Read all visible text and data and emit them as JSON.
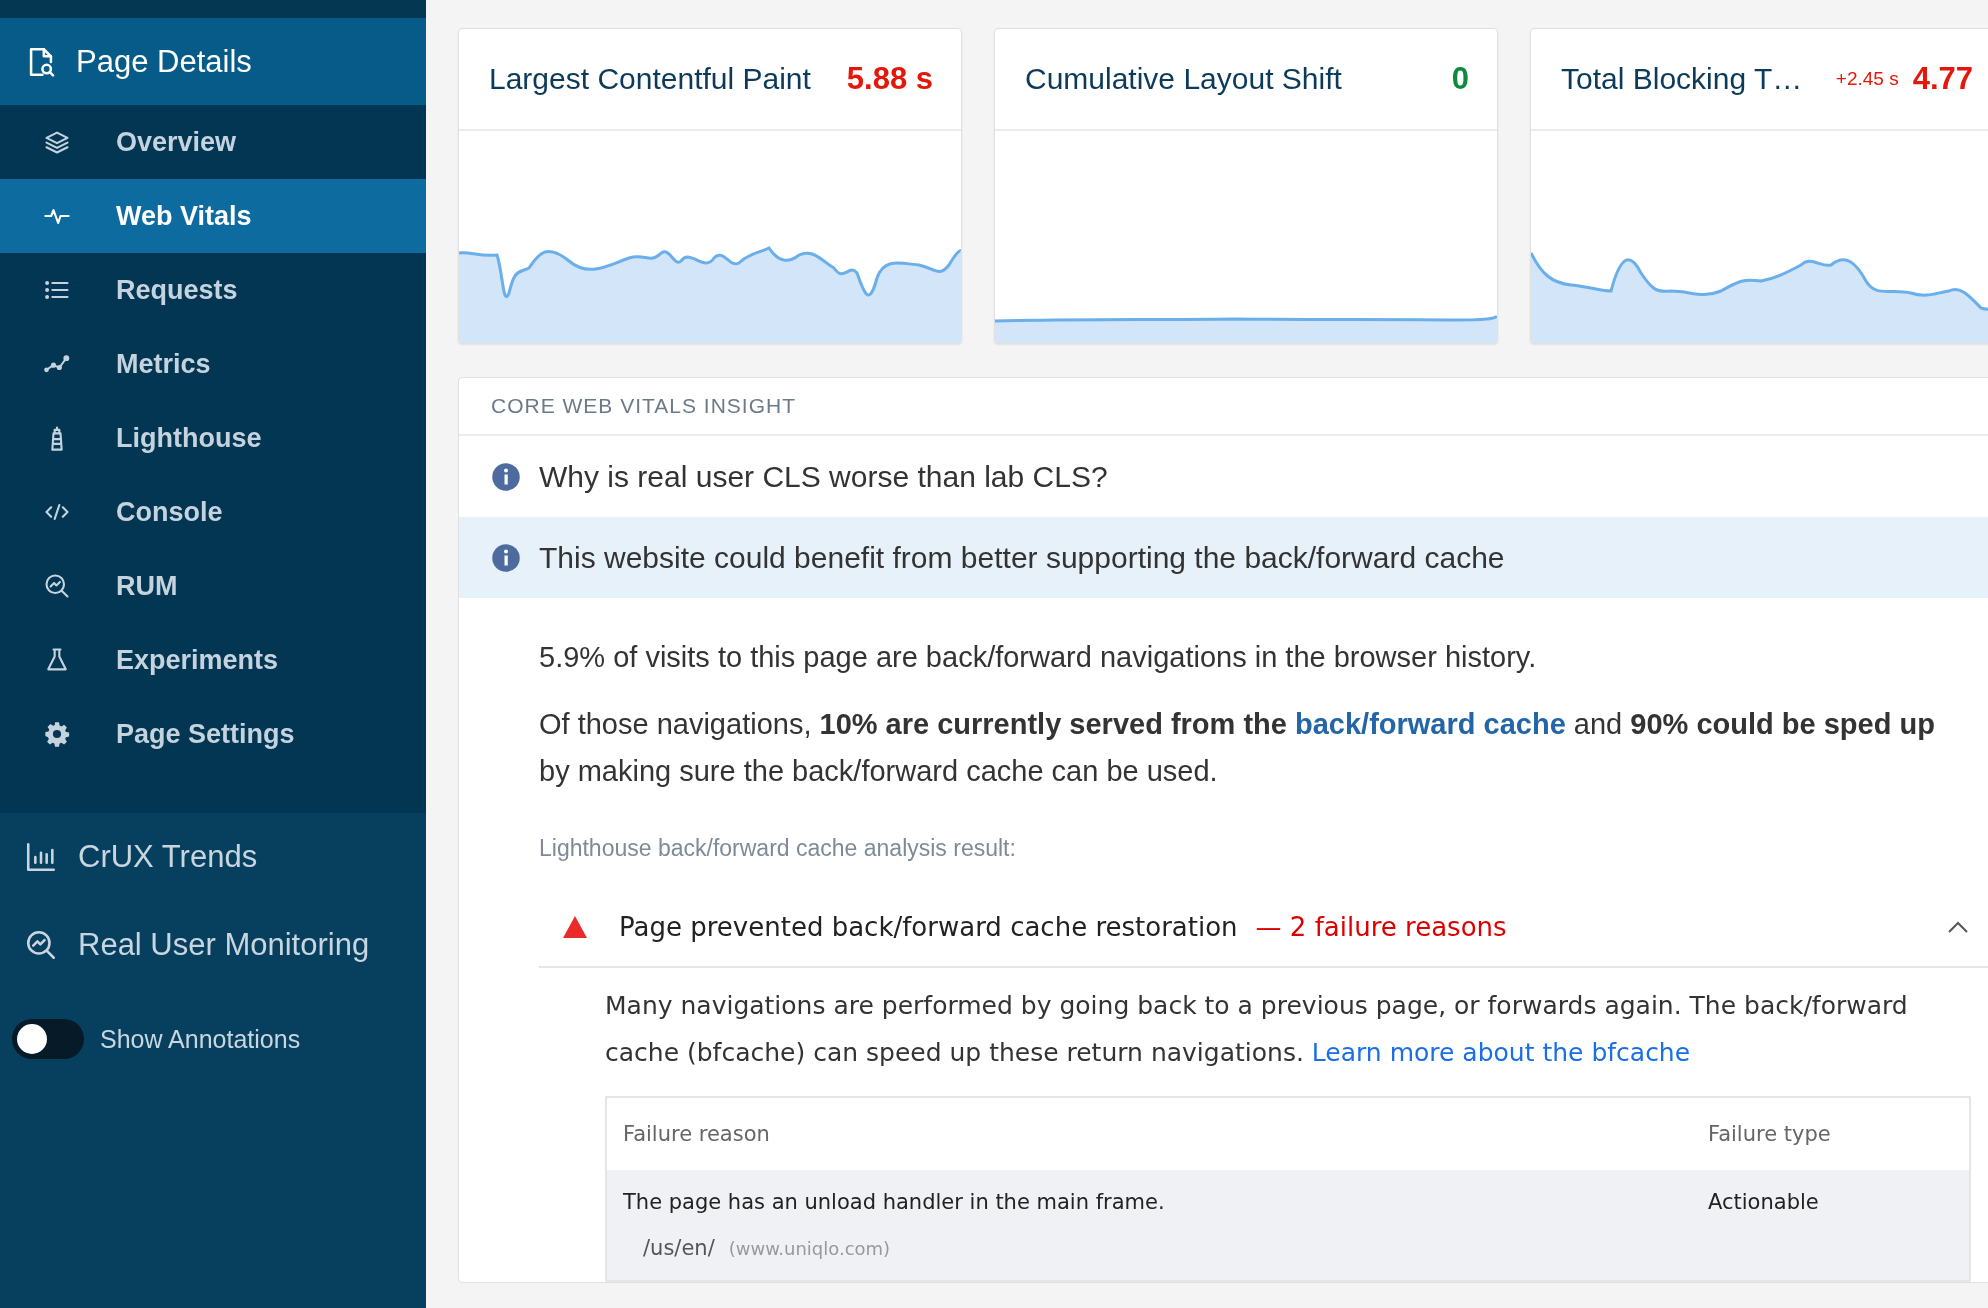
{
  "sidebar": {
    "header": {
      "title": "Page Details"
    },
    "items": [
      {
        "label": "Overview",
        "selected": false
      },
      {
        "label": "Web Vitals",
        "selected": true
      },
      {
        "label": "Requests",
        "selected": false
      },
      {
        "label": "Metrics",
        "selected": false
      },
      {
        "label": "Lighthouse",
        "selected": false
      },
      {
        "label": "Console",
        "selected": false
      },
      {
        "label": "RUM",
        "selected": false
      },
      {
        "label": "Experiments",
        "selected": false
      },
      {
        "label": "Page Settings",
        "selected": false
      }
    ],
    "links": [
      {
        "label": "CrUX Trends"
      },
      {
        "label": "Real User Monitoring"
      }
    ],
    "toggle": {
      "label": "Show Annotations",
      "on": false
    }
  },
  "metric_cards": [
    {
      "title": "Largest Contentful Paint",
      "value": "5.88 s",
      "color": "#e3170a"
    },
    {
      "title": "Cumulative Layout Shift",
      "value": "0",
      "color": "#0e8a3e"
    },
    {
      "title": "Total Blocking T…",
      "delta": "+2.45 s",
      "value": "4.77",
      "color": "#e3170a"
    }
  ],
  "insight": {
    "heading": "CORE WEB VITALS INSIGHT",
    "items": [
      {
        "text": "Why is real user CLS worse than lab CLS?",
        "selected": false
      },
      {
        "text": "This website could benefit from better supporting the back/forward cache",
        "selected": true
      }
    ],
    "paragraph_1": "5.9% of visits to this page are back/forward navigations in the browser history.",
    "paragraph_2": {
      "before": "Of those navigations, **10% are currently served from the**",
      "link": "back/forward cache",
      "after": "and **90% could be sped up** by making sure the back/forward cache can be used."
    },
    "analysis_label": "Lighthouse back/forward cache analysis result:",
    "audit": {
      "title": "Page prevented back/forward cache restoration",
      "failures": "— 2 failure reasons",
      "expanded": true,
      "description": "Many navigations are performed by going back to a previous page, or forwards again. The back/forward cache (bfcache) can speed up these return navigations.",
      "link": "Learn more about the bfcache",
      "table": {
        "columns": [
          "Failure reason",
          "Failure type"
        ],
        "rows": [
          {
            "reason": "The page has an unload handler in the main frame.",
            "type": "Actionable",
            "url": "/us/en/",
            "host": "(www.uniqlo.com)"
          }
        ]
      }
    }
  }
}
